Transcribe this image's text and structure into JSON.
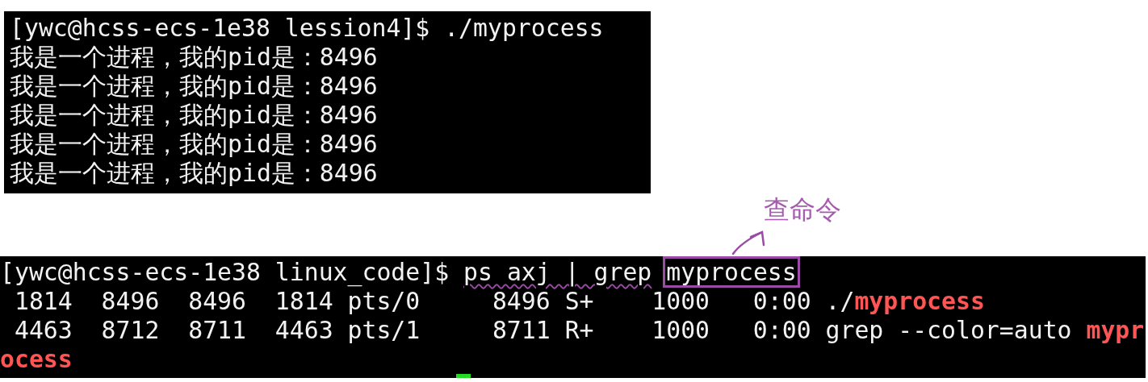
{
  "terminals": [
    {
      "lines": [
        {
          "segments": [
            {
              "text": "[ywc@hcss-ecs-1e38 lession4]$ ./myprocess",
              "highlight": false
            }
          ]
        },
        {
          "segments": [
            {
              "text": "我是一个进程，我的pid是：8496",
              "highlight": false
            }
          ]
        },
        {
          "segments": [
            {
              "text": "我是一个进程，我的pid是：8496",
              "highlight": false
            }
          ]
        },
        {
          "segments": [
            {
              "text": "我是一个进程，我的pid是：8496",
              "highlight": false
            }
          ]
        },
        {
          "segments": [
            {
              "text": "我是一个进程，我的pid是：8496",
              "highlight": false
            }
          ]
        },
        {
          "segments": [
            {
              "text": "我是一个进程，我的pid是：8496",
              "highlight": false
            }
          ]
        }
      ],
      "cursor_visible": false
    },
    {
      "lines": [
        {
          "segments": [
            {
              "text": "[ywc@hcss-ecs-1e38 linux_code]$ ",
              "highlight": false
            },
            {
              "text": "ps axj | grep",
              "highlight": false,
              "underlined": true
            },
            {
              "text": "myprocess",
              "highlight": false,
              "boxed": true
            }
          ]
        },
        {
          "segments": [
            {
              "text": " 1814  8496  8496  1814 pts/0     8496 S+    1000   0:00 ./",
              "highlight": false
            },
            {
              "text": "myprocess",
              "highlight": true
            }
          ]
        },
        {
          "segments": [
            {
              "text": " 4463  8712  8711  4463 pts/1     8711 R+    1000   0:00 grep --color=auto ",
              "highlight": false
            },
            {
              "text": "mypr",
              "highlight": true
            }
          ]
        },
        {
          "segments": [
            {
              "text": "ocess",
              "highlight": true
            }
          ]
        }
      ],
      "cursor_visible": true
    }
  ],
  "annotation": {
    "label": "查命令"
  }
}
